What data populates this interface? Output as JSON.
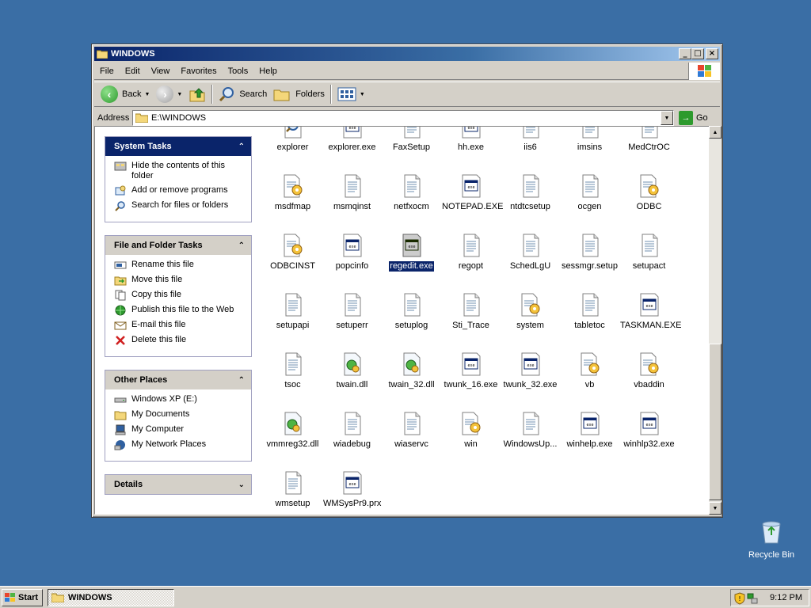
{
  "window": {
    "title": "WINDOWS",
    "menu": [
      "File",
      "Edit",
      "View",
      "Favorites",
      "Tools",
      "Help"
    ],
    "toolbar": {
      "back": "Back",
      "search": "Search",
      "folders": "Folders"
    },
    "address": {
      "label": "Address",
      "value": "E:\\WINDOWS",
      "go": "Go"
    }
  },
  "panes": {
    "system_tasks": {
      "title": "System Tasks",
      "items": [
        "Hide the contents of this folder",
        "Add or remove programs",
        "Search for files or folders"
      ]
    },
    "file_folder_tasks": {
      "title": "File and Folder Tasks",
      "items": [
        "Rename this file",
        "Move this file",
        "Copy this file",
        "Publish this file to the Web",
        "E-mail this file",
        "Delete this file"
      ]
    },
    "other_places": {
      "title": "Other Places",
      "items": [
        "Windows XP (E:)",
        "My Documents",
        "My Computer",
        "My Network Places"
      ]
    },
    "details": {
      "title": "Details"
    }
  },
  "files": [
    {
      "name": "explorer",
      "icon": "search-app-icon"
    },
    {
      "name": "explorer.exe",
      "icon": "exe-icon"
    },
    {
      "name": "FaxSetup",
      "icon": "text-file-icon"
    },
    {
      "name": "hh.exe",
      "icon": "exe-icon"
    },
    {
      "name": "iis6",
      "icon": "text-file-icon"
    },
    {
      "name": "imsins",
      "icon": "text-file-icon"
    },
    {
      "name": "MedCtrOC",
      "icon": "text-file-icon"
    },
    {
      "name": "msdfmap",
      "icon": "config-file-icon"
    },
    {
      "name": "msmqinst",
      "icon": "text-file-icon"
    },
    {
      "name": "netfxocm",
      "icon": "text-file-icon"
    },
    {
      "name": "NOTEPAD.EXE",
      "icon": "exe-icon"
    },
    {
      "name": "ntdtcsetup",
      "icon": "text-file-icon"
    },
    {
      "name": "ocgen",
      "icon": "text-file-icon"
    },
    {
      "name": "ODBC",
      "icon": "config-file-icon"
    },
    {
      "name": "ODBCINST",
      "icon": "config-file-icon"
    },
    {
      "name": "popcinfo",
      "icon": "exe-icon"
    },
    {
      "name": "regedit.exe",
      "icon": "exe-icon",
      "selected": true
    },
    {
      "name": "regopt",
      "icon": "text-file-icon"
    },
    {
      "name": "SchedLgU",
      "icon": "text-file-icon"
    },
    {
      "name": "sessmgr.setup",
      "icon": "text-file-icon"
    },
    {
      "name": "setupact",
      "icon": "text-file-icon"
    },
    {
      "name": "setupapi",
      "icon": "text-file-icon"
    },
    {
      "name": "setuperr",
      "icon": "text-file-icon"
    },
    {
      "name": "setuplog",
      "icon": "text-file-icon"
    },
    {
      "name": "Sti_Trace",
      "icon": "text-file-icon"
    },
    {
      "name": "system",
      "icon": "config-file-icon"
    },
    {
      "name": "tabletoc",
      "icon": "text-file-icon"
    },
    {
      "name": "TASKMAN.EXE",
      "icon": "exe-icon"
    },
    {
      "name": "tsoc",
      "icon": "text-file-icon"
    },
    {
      "name": "twain.dll",
      "icon": "dll-icon"
    },
    {
      "name": "twain_32.dll",
      "icon": "dll-icon"
    },
    {
      "name": "twunk_16.exe",
      "icon": "exe-icon"
    },
    {
      "name": "twunk_32.exe",
      "icon": "exe-icon"
    },
    {
      "name": "vb",
      "icon": "config-file-icon"
    },
    {
      "name": "vbaddin",
      "icon": "config-file-icon"
    },
    {
      "name": "vmmreg32.dll",
      "icon": "dll-icon"
    },
    {
      "name": "wiadebug",
      "icon": "text-file-icon"
    },
    {
      "name": "wiaservc",
      "icon": "text-file-icon"
    },
    {
      "name": "win",
      "icon": "config-file-icon"
    },
    {
      "name": "WindowsUp...",
      "icon": "text-file-icon"
    },
    {
      "name": "winhelp.exe",
      "icon": "exe-icon"
    },
    {
      "name": "winhlp32.exe",
      "icon": "exe-icon"
    },
    {
      "name": "wmsetup",
      "icon": "text-file-icon"
    },
    {
      "name": "WMSysPr9.prx",
      "icon": "exe-icon"
    }
  ],
  "desktop": {
    "recycle_bin": "Recycle Bin"
  },
  "taskbar": {
    "start": "Start",
    "task": "WINDOWS",
    "clock": "9:12 PM"
  }
}
